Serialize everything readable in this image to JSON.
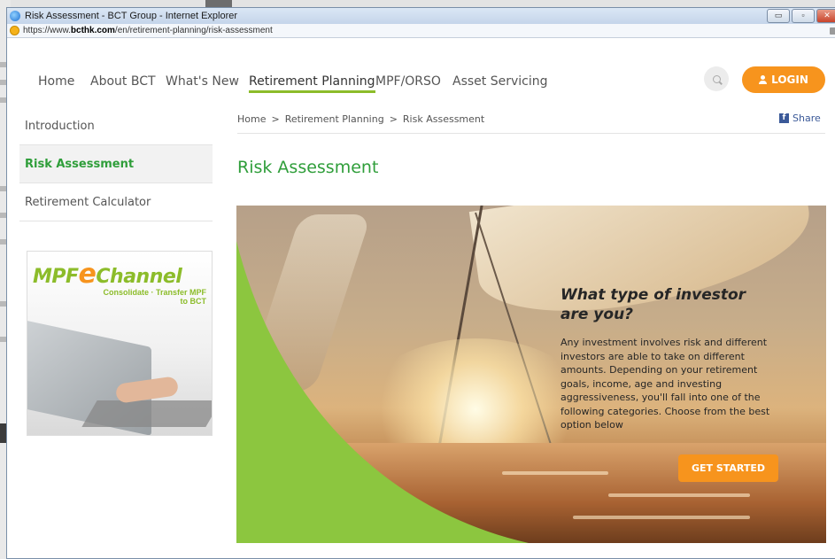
{
  "window": {
    "title": "Risk Assessment - BCT Group - Internet Explorer",
    "url_prefix": "https://www.",
    "url_domain": "bcthk.com",
    "url_path": "/en/retirement-planning/risk-assessment",
    "minimize": "▭",
    "maximize": "▫",
    "close": "✕"
  },
  "nav": {
    "items": [
      "Home",
      "About BCT",
      "What's New",
      "Retirement Planning",
      "MPF/ORSO",
      "Asset Servicing"
    ],
    "active": "Retirement Planning",
    "login_label": "LOGIN"
  },
  "sidebar": {
    "items": [
      "Introduction",
      "Risk Assessment",
      "Retirement Calculator"
    ],
    "active": "Risk Assessment"
  },
  "promo": {
    "brand_left": "MPF",
    "brand_e": "e",
    "brand_right": "Channel",
    "tagline": "Consolidate · Transfer MPF to BCT"
  },
  "breadcrumb": {
    "items": [
      "Home",
      "Retirement Planning",
      "Risk Assessment"
    ],
    "separator": ">"
  },
  "share_label": "Share",
  "page_title": "Risk Assessment",
  "hero": {
    "heading": "What type of investor are you?",
    "body": "Any investment involves risk and different investors are able to take on different amounts. Depending on your retirement goals, income, age and investing aggressiveness, you'll fall into one of the following categories. Choose from the best option below",
    "button_label": "GET STARTED"
  },
  "colors": {
    "accent_green": "#8cbc2a",
    "title_green": "#2f9e3a",
    "orange": "#f7941d",
    "facebook_blue": "#3b5998"
  }
}
